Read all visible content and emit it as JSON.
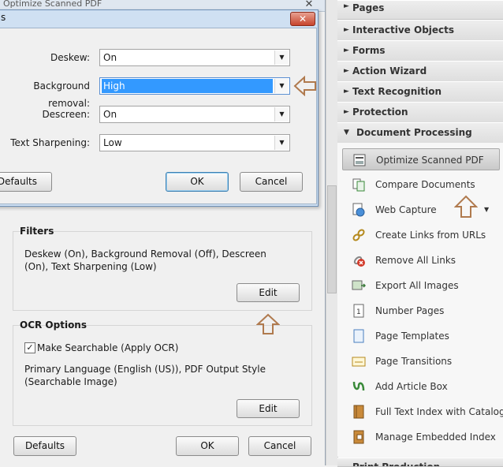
{
  "background_window": {
    "title": "Optimize Scanned PDF",
    "close_glyph": "✕",
    "filters": {
      "label": "Filters",
      "summary": "Deskew (On), Background Removal (Off), Descreen (On), Text Sharpening (Low)",
      "edit_label": "Edit"
    },
    "ocr": {
      "label": "OCR Options",
      "make_searchable_label": "Make Searchable (Apply OCR)",
      "make_searchable_checked": true,
      "summary": "Primary Language (English (US)), PDF Output Style (Searchable Image)",
      "edit_label": "Edit"
    },
    "buttons": {
      "defaults": "Defaults",
      "ok": "OK",
      "cancel": "Cancel"
    }
  },
  "filter_dialog": {
    "title_fragment": "s",
    "close_glyph": "✕",
    "rows": [
      {
        "label": "Deskew:",
        "value": "On",
        "selected": false
      },
      {
        "label": "Background removal:",
        "value": "High",
        "selected": true
      },
      {
        "label": "Descreen:",
        "value": "On",
        "selected": false
      },
      {
        "label": "Text Sharpening:",
        "value": "Low",
        "selected": false
      }
    ],
    "buttons": {
      "defaults": "Defaults",
      "ok": "OK",
      "cancel": "Cancel"
    }
  },
  "tools_pane": {
    "sections": [
      {
        "label": "Pages",
        "expanded": false
      },
      {
        "label": "Interactive Objects",
        "expanded": false
      },
      {
        "label": "Forms",
        "expanded": false
      },
      {
        "label": "Action Wizard",
        "expanded": false
      },
      {
        "label": "Text Recognition",
        "expanded": false
      },
      {
        "label": "Protection",
        "expanded": false
      },
      {
        "label": "Document Processing",
        "expanded": true
      }
    ],
    "items": [
      {
        "label": "Optimize Scanned PDF",
        "icon": "scanner-icon",
        "active": true
      },
      {
        "label": "Compare Documents",
        "icon": "compare-icon",
        "active": false
      },
      {
        "label": "Web Capture",
        "icon": "globe-icon",
        "active": false,
        "has_dropdown": true
      },
      {
        "label": "Create Links from URLs",
        "icon": "link-icon",
        "active": false
      },
      {
        "label": "Remove All Links",
        "icon": "remove-link-icon",
        "active": false
      },
      {
        "label": "Export All Images",
        "icon": "image-export-icon",
        "active": false
      },
      {
        "label": "Number Pages",
        "icon": "number-pages-icon",
        "active": false
      },
      {
        "label": "Page Templates",
        "icon": "page-template-icon",
        "active": false
      },
      {
        "label": "Page Transitions",
        "icon": "page-transition-icon",
        "active": false
      },
      {
        "label": "Add Article Box",
        "icon": "article-box-icon",
        "active": false
      },
      {
        "label": "Full Text Index with Catalog",
        "icon": "catalog-icon",
        "active": false
      },
      {
        "label": "Manage Embedded Index",
        "icon": "embedded-index-icon",
        "active": false
      }
    ],
    "bottom_section": "Print Production"
  },
  "annotation_color": "#b07a4e"
}
